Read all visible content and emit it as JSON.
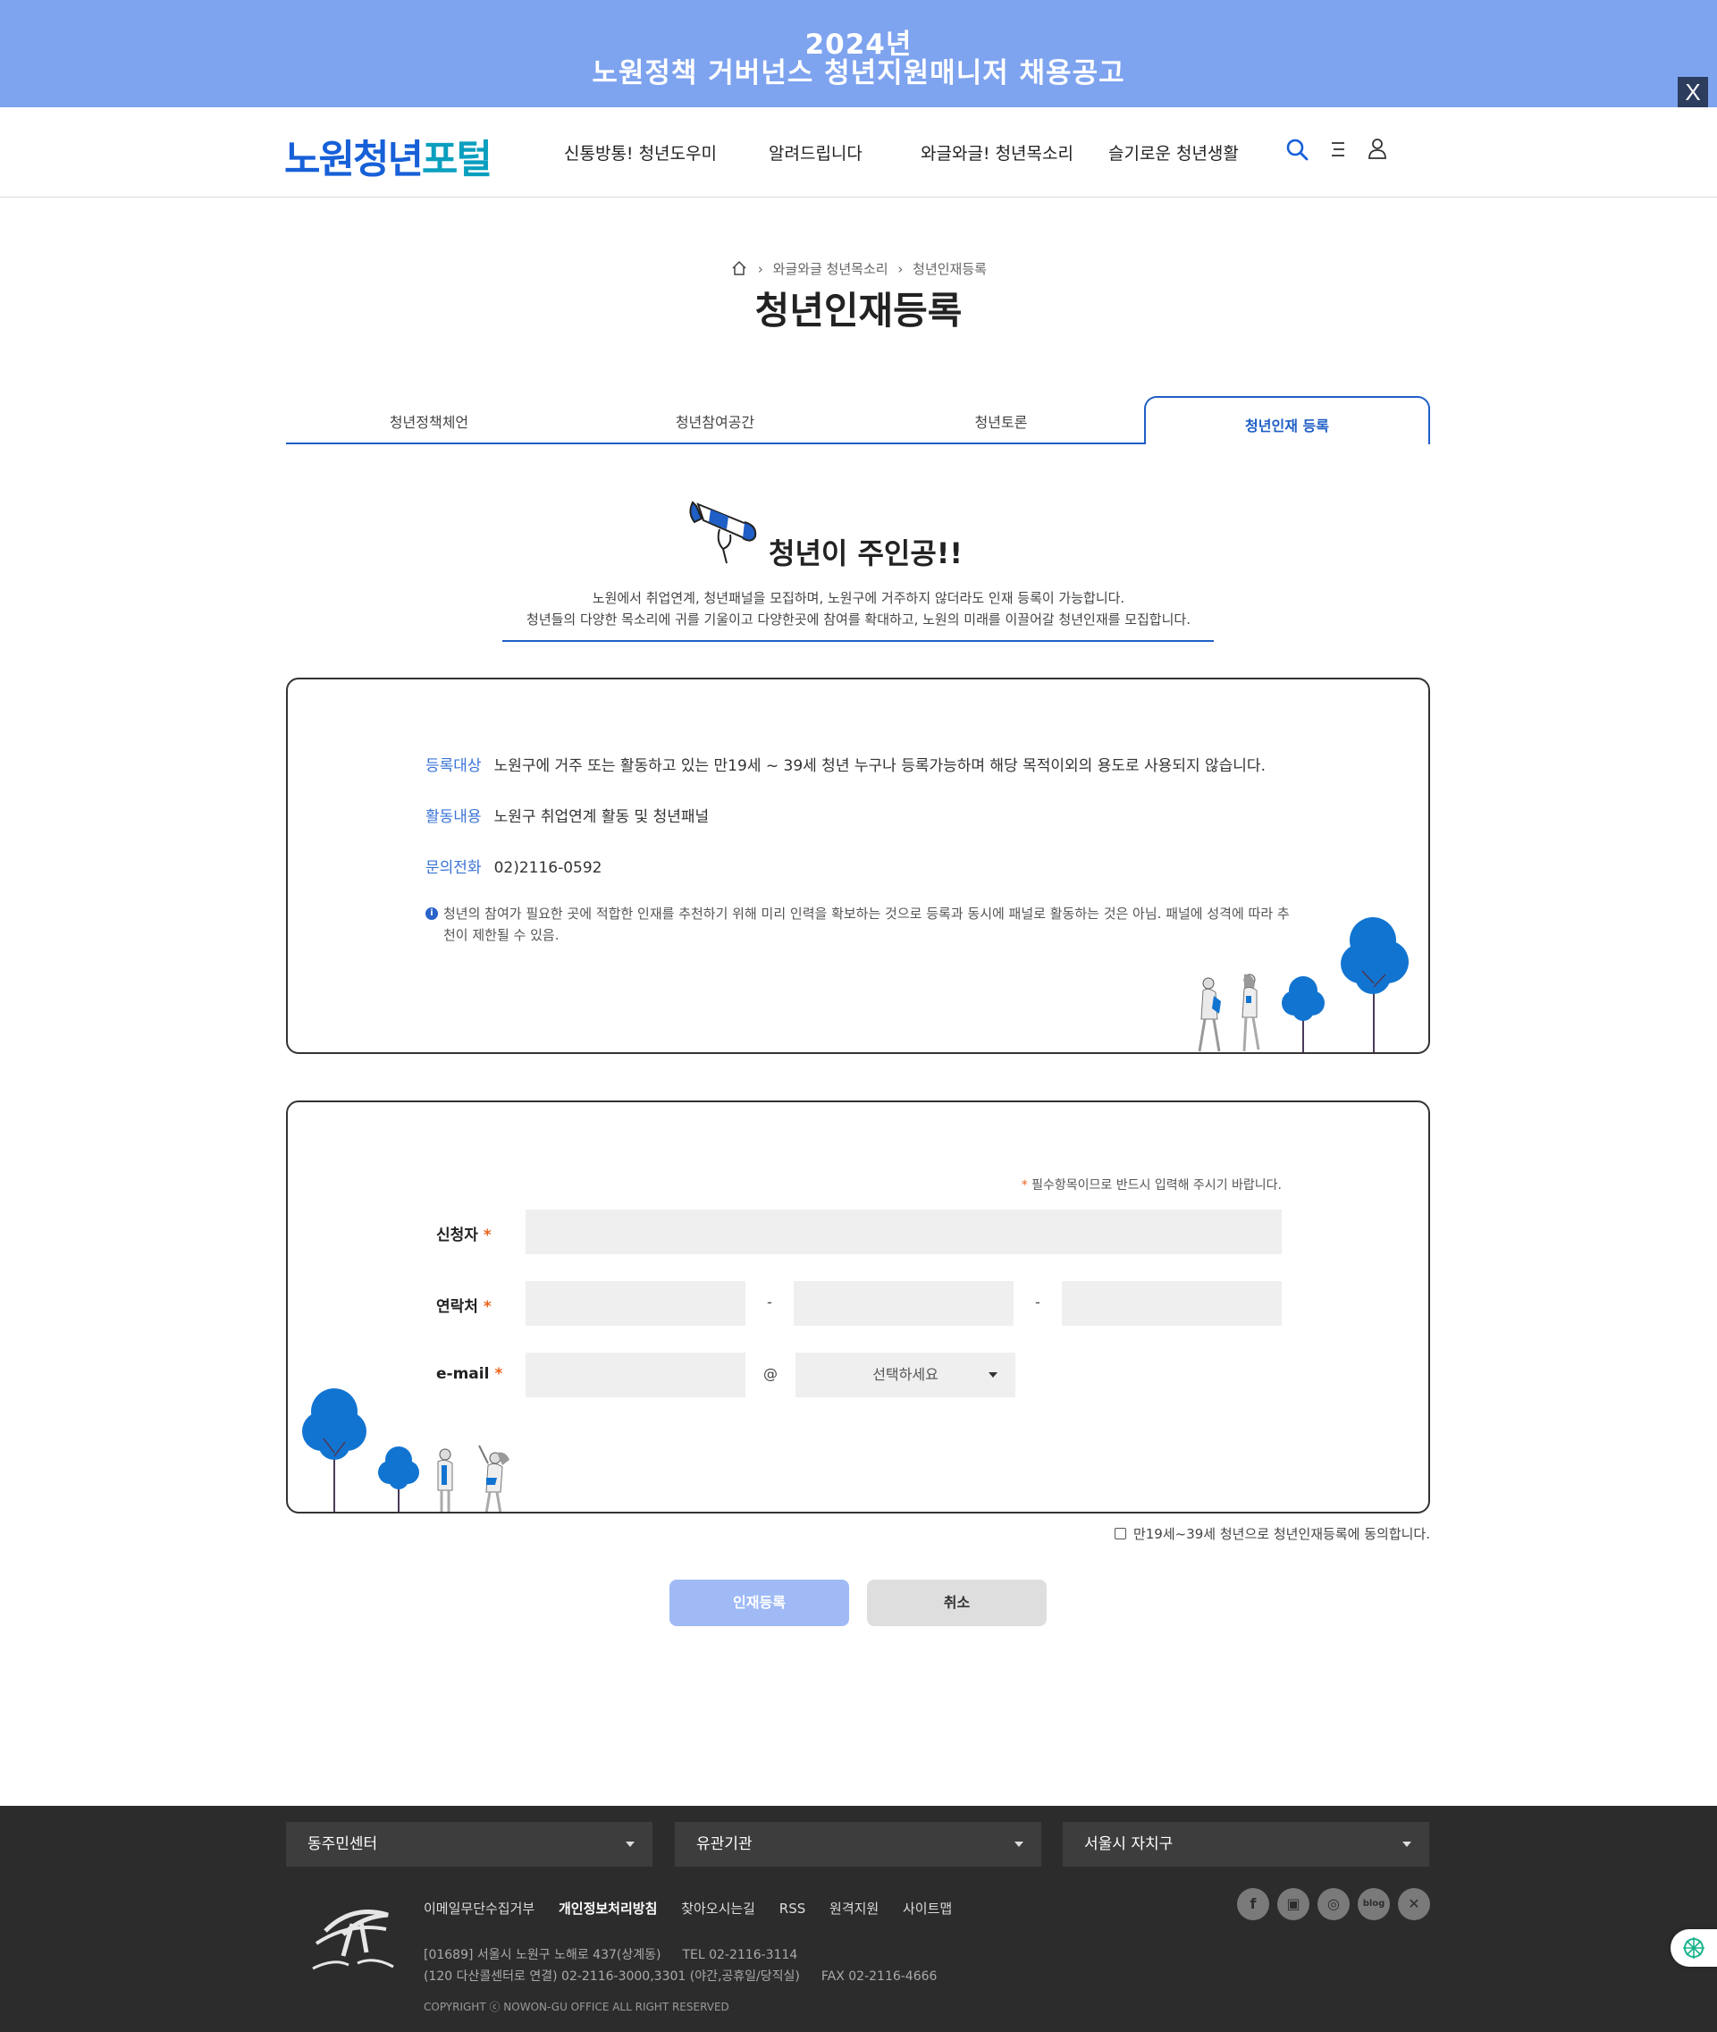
{
  "banner": {
    "line1": "2024년",
    "line2": "노원정책 거버넌스 청년지원매니저 채용공고",
    "close": "X"
  },
  "header": {
    "logo_a": "노원청년",
    "logo_b": "포털",
    "nav": [
      "신통방통! 청년도우미",
      "알려드립니다",
      "와글와글! 청년목소리",
      "슬기로운 청년생활"
    ],
    "icons": [
      "search-icon",
      "menu-icon",
      "user-icon"
    ]
  },
  "breadcrumb": {
    "home_icon": "home-icon",
    "item1": "와글와글 청년목소리",
    "item2": "청년인재등록"
  },
  "page_title": "청년인재등록",
  "tabs": [
    "청년정책체언",
    "청년참여공간",
    "청년토론",
    "청년인재 등록"
  ],
  "intro": {
    "title": "청년이 주인공!!",
    "line1": "노원에서 취업연계, 청년패널을 모집하며, 노원구에 거주하지 않더라도 인재 등록이 가능합니다.",
    "line2": "청년들의 다양한 목소리에 귀를 기울이고 다양한곳에 참여를 확대하고, 노원의 미래를 이끌어갈 청년인재를 모집합니다."
  },
  "info": {
    "target_label": "등록대상",
    "target_value": "노원구에 거주 또는 활동하고 있는 만19세 ~ 39세 청년 누구나 등록가능하며 해당 목적이외의 용도로 사용되지 않습니다.",
    "activity_label": "활동내용",
    "activity_value": "노원구 취업연계 활동 및 청년패널",
    "phone_label": "문의전화",
    "phone_value": "02)2116-0592",
    "notice": "청년의 참여가 필요한 곳에 적합한 인재를 추천하기 위해 미리 인력을 확보하는 것으로 등록과 동시에 패널로 활동하는 것은 아님. 패널에 성격에 따라 추천이 제한될 수 있음."
  },
  "form": {
    "required_note": "필수항목이므로 반드시 입력해 주시기 바랍니다.",
    "star": "*",
    "name_label": "신청자",
    "contact_label": "연락처",
    "email_label": "e-mail",
    "dash": "-",
    "at": "@",
    "email_domain_select": "선택하세요"
  },
  "agree_text": "만19세~39세 청년으로 청년인재등록에 동의합니다.",
  "buttons": {
    "submit": "인재등록",
    "cancel": "취소"
  },
  "footer": {
    "selects": [
      "동주민센터",
      "유관기관",
      "서울시 자치구"
    ],
    "links": [
      "이메일무단수집거부",
      "개인정보처리방침",
      "찾아오시는길",
      "RSS",
      "원격지원",
      "사이트맵"
    ],
    "address1": "[01689] 서울시 노원구 노해로 437(상계동)",
    "tel": "TEL 02-2116-3114",
    "address2": "(120 다산콜센터로 연결) 02-2116-3000,3301 (야간,공휴일/당직실)",
    "fax": "FAX 02-2116-4666",
    "copyright": "COPYRIGHT ⓒ NOWON-GU OFFICE ALL RIGHT RESERVED",
    "social_icons": [
      "facebook-icon",
      "podcast-icon",
      "instagram-icon",
      "blog-icon",
      "x-icon"
    ],
    "social_labels": [
      "f",
      "▣",
      "◎",
      "blog",
      "✕"
    ]
  },
  "colors": {
    "banner": "#7ea3ef",
    "brand_blue": "#1760d8",
    "accent": "#1f5fc6",
    "required": "#e8641b",
    "footer": "#2c2c2c"
  }
}
